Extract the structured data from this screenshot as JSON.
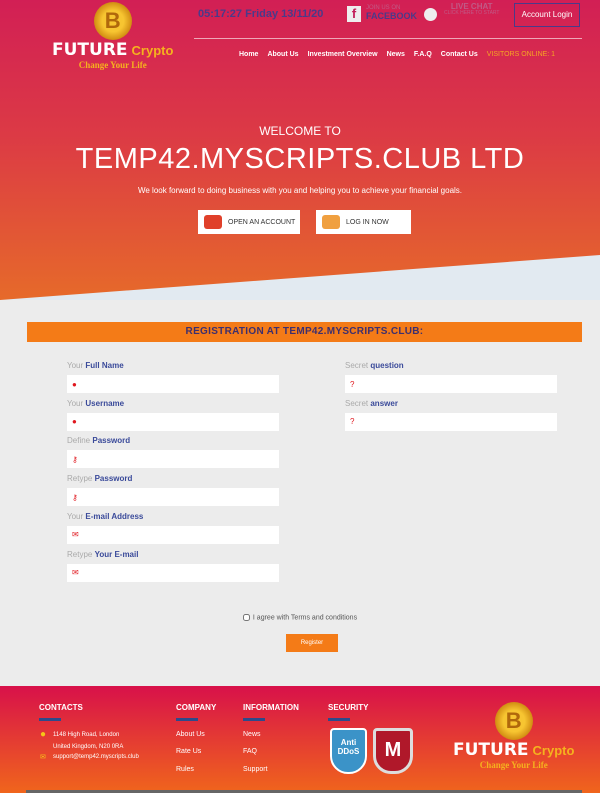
{
  "header": {
    "logo": {
      "word1": "FUTURE",
      "word2": "Crypto",
      "slogan": "Change Your Life",
      "coin": "B"
    },
    "clock": "05:17:27 Friday 13/11/20",
    "facebook": {
      "small": "JOIN US ON",
      "big": "FACEBOOK",
      "icon": "facebook-icon"
    },
    "chat": {
      "big": "LIVE CHAT",
      "small": "CLICK HERE TO START",
      "icon": "chat-icon"
    },
    "account_login": "Account Login",
    "nav": [
      "Home",
      "About Us",
      "Investment Overview",
      "News",
      "F.A.Q",
      "Contact Us"
    ],
    "visitors": "VISITORS ONLINE: 1"
  },
  "hero": {
    "welcome": "WELCOME TO",
    "title": "TEMP42.MYSCRIPTS.CLUB LTD",
    "tagline": "We look forward to doing business with you and helping you to achieve your financial goals.",
    "open_account": "OPEN AN ACCOUNT",
    "login": "LOG IN NOW"
  },
  "form": {
    "heading": "REGISTRATION AT TEMP42.MYSCRIPTS.CLUB:",
    "left": [
      {
        "pre": "Your",
        "label": "Full Name",
        "icon": "user-icon"
      },
      {
        "pre": "Your",
        "label": "Username",
        "icon": "user-icon"
      },
      {
        "pre": "Define",
        "label": "Password",
        "icon": "key-icon"
      },
      {
        "pre": "Retype",
        "label": "Password",
        "icon": "key-icon"
      },
      {
        "pre": "Your",
        "label": "E-mail Address",
        "icon": "envelope-icon"
      },
      {
        "pre": "Retype",
        "label": "Your E-mail",
        "icon": "envelope-icon"
      }
    ],
    "right": [
      {
        "pre": "Secret",
        "label": "question",
        "icon": "question-icon"
      },
      {
        "pre": "Secret",
        "label": "answer",
        "icon": "question-icon"
      }
    ],
    "agree": "I agree with Terms and conditions",
    "register": "Register"
  },
  "footer": {
    "contacts": {
      "title": "CONTACTS",
      "address1": "1148 High Road, London",
      "address2": "United Kingdom, N20 0RA",
      "email": "support@temp42.myscripts.club"
    },
    "company": {
      "title": "COMPANY",
      "links": [
        "About Us",
        "Rate Us",
        "Rules"
      ]
    },
    "information": {
      "title": "INFORMATION",
      "links": [
        "News",
        "FAQ",
        "Support"
      ]
    },
    "security": {
      "title": "SECURITY",
      "badge1": "Anti DDoS",
      "badge2": "M"
    }
  },
  "colors": {
    "accent": "#f47b17",
    "crimson": "#d21f55",
    "navy": "#3a4a9a"
  }
}
